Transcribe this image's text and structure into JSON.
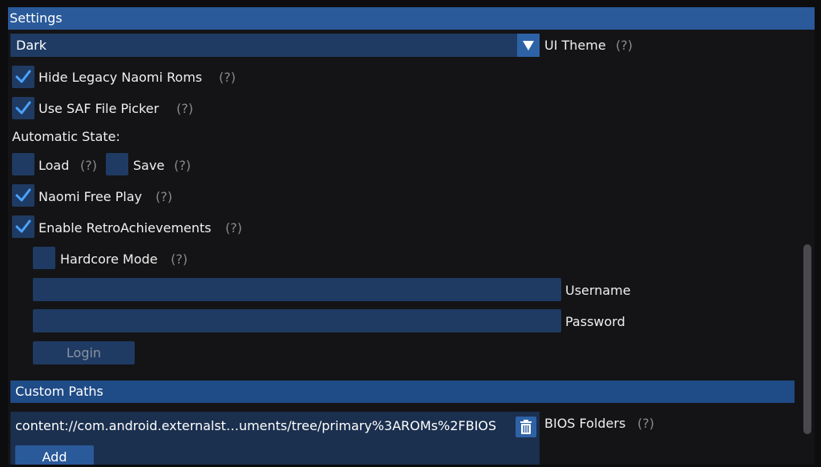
{
  "window": {
    "title": "Settings"
  },
  "ui_theme": {
    "selected": "Dark",
    "label": "UI Theme",
    "help": "(?)"
  },
  "options": {
    "hide_legacy": {
      "label": "Hide Legacy Naomi Roms",
      "help": "(?)",
      "checked": true
    },
    "saf_picker": {
      "label": "Use SAF File Picker",
      "help": "(?)",
      "checked": true
    },
    "automatic_state_label": "Automatic State:",
    "load": {
      "label": "Load",
      "help": "(?)",
      "checked": false
    },
    "save": {
      "label": "Save",
      "help": "(?)",
      "checked": false
    },
    "naomi_free_play": {
      "label": "Naomi Free Play",
      "help": "(?)",
      "checked": true
    },
    "retroachievements": {
      "label": "Enable RetroAchievements",
      "help": "(?)",
      "checked": true
    },
    "hardcore": {
      "label": "Hardcore Mode",
      "help": "(?)",
      "checked": false
    }
  },
  "login": {
    "username_label": "Username",
    "username_value": "",
    "password_label": "Password",
    "password_value": "",
    "login_button": "Login"
  },
  "custom_paths": {
    "header": "Custom Paths",
    "bios_path": "content://com.android.externalst…uments/tree/primary%3AROMs%2FBIOS",
    "bios_label": "BIOS Folders",
    "bios_help": "(?)",
    "add_button": "Add"
  },
  "colors": {
    "accent": "#2a5a9a",
    "frame": "#1f3b63",
    "check": "#4aa3ff"
  }
}
